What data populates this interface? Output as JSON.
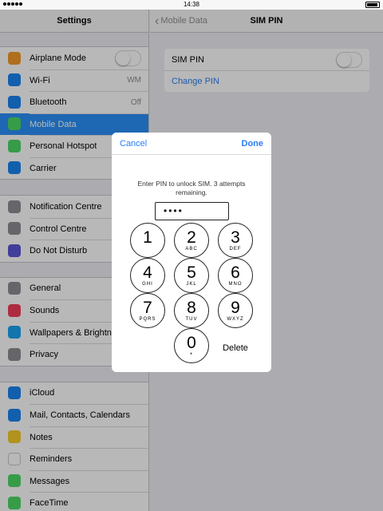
{
  "status_bar": {
    "time": "14:38"
  },
  "sidebar": {
    "title": "Settings",
    "groups": [
      {
        "items": [
          {
            "label": "Airplane Mode",
            "icon": "airplane-icon",
            "color": "#f49a29",
            "control": "toggle"
          },
          {
            "label": "Wi-Fi",
            "icon": "wifi-icon",
            "color": "#1a84f2",
            "value": "WM"
          },
          {
            "label": "Bluetooth",
            "icon": "bluetooth-icon",
            "color": "#1a84f2",
            "value": "Off"
          },
          {
            "label": "Mobile Data",
            "icon": "antenna-icon",
            "color": "#4cd964",
            "selected": true
          },
          {
            "label": "Personal Hotspot",
            "icon": "hotspot-icon",
            "color": "#4cd964"
          },
          {
            "label": "Carrier",
            "icon": "phone-icon",
            "color": "#1a84f2"
          }
        ]
      },
      {
        "items": [
          {
            "label": "Notification Centre",
            "icon": "notification-icon",
            "color": "#8e8e93"
          },
          {
            "label": "Control Centre",
            "icon": "control-icon",
            "color": "#8e8e93"
          },
          {
            "label": "Do Not Disturb",
            "icon": "moon-icon",
            "color": "#5b55d6"
          }
        ]
      },
      {
        "items": [
          {
            "label": "General",
            "icon": "gear-icon",
            "color": "#8e8e93"
          },
          {
            "label": "Sounds",
            "icon": "speaker-icon",
            "color": "#f23e5b"
          },
          {
            "label": "Wallpapers & Brightness",
            "icon": "wallpaper-icon",
            "color": "#1aa3f2"
          },
          {
            "label": "Privacy",
            "icon": "hand-icon",
            "color": "#8e8e93"
          }
        ]
      },
      {
        "items": [
          {
            "label": "iCloud",
            "icon": "cloud-icon",
            "color": "#1a84f2"
          },
          {
            "label": "Mail, Contacts, Calendars",
            "icon": "mail-icon",
            "color": "#1a84f2"
          },
          {
            "label": "Notes",
            "icon": "notes-icon",
            "color": "#f5cc2a"
          },
          {
            "label": "Reminders",
            "icon": "reminders-icon",
            "color": "#ffffff"
          },
          {
            "label": "Messages",
            "icon": "messages-icon",
            "color": "#4cd964"
          },
          {
            "label": "FaceTime",
            "icon": "facetime-icon",
            "color": "#4cd964"
          }
        ]
      }
    ]
  },
  "detail": {
    "back_label": "Mobile Data",
    "title": "SIM PIN",
    "sim_pin_label": "SIM PIN",
    "change_pin_label": "Change PIN"
  },
  "modal": {
    "cancel": "Cancel",
    "done": "Done",
    "prompt": "Enter PIN to unlock SIM. 3 attempts remaining.",
    "pin_mask": "••••",
    "delete": "Delete",
    "keys": [
      {
        "digit": "1",
        "letters": ""
      },
      {
        "digit": "2",
        "letters": "ABC"
      },
      {
        "digit": "3",
        "letters": "DEF"
      },
      {
        "digit": "4",
        "letters": "GHI"
      },
      {
        "digit": "5",
        "letters": "JKL"
      },
      {
        "digit": "6",
        "letters": "MNO"
      },
      {
        "digit": "7",
        "letters": "PQRS"
      },
      {
        "digit": "8",
        "letters": "TUV"
      },
      {
        "digit": "9",
        "letters": "WXYZ"
      },
      {
        "digit": "0",
        "letters": "+"
      }
    ]
  }
}
